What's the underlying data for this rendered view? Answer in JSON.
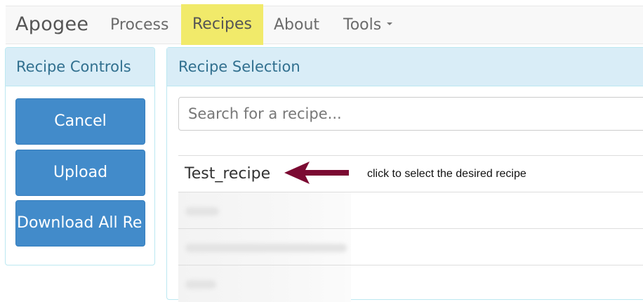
{
  "navbar": {
    "brand": "Apogee",
    "items": [
      {
        "label": "Process"
      },
      {
        "label": "Recipes",
        "highlighted": true
      },
      {
        "label": "About"
      },
      {
        "label": "Tools",
        "dropdown": true
      }
    ],
    "highlight_color": "#f1ea6a"
  },
  "recipe_controls": {
    "title": "Recipe Controls",
    "buttons": {
      "cancel": "Cancel",
      "upload": "Upload",
      "download": "Download All Re"
    },
    "button_color": "#428bca"
  },
  "recipe_selection": {
    "title": "Recipe Selection",
    "search_placeholder": "Search for a recipe...",
    "recipes": [
      "Test_recipe"
    ],
    "blurred_rows": 3
  },
  "annotation": {
    "text": "click to select the desired recipe",
    "arrow_color": "#7b0a32"
  }
}
